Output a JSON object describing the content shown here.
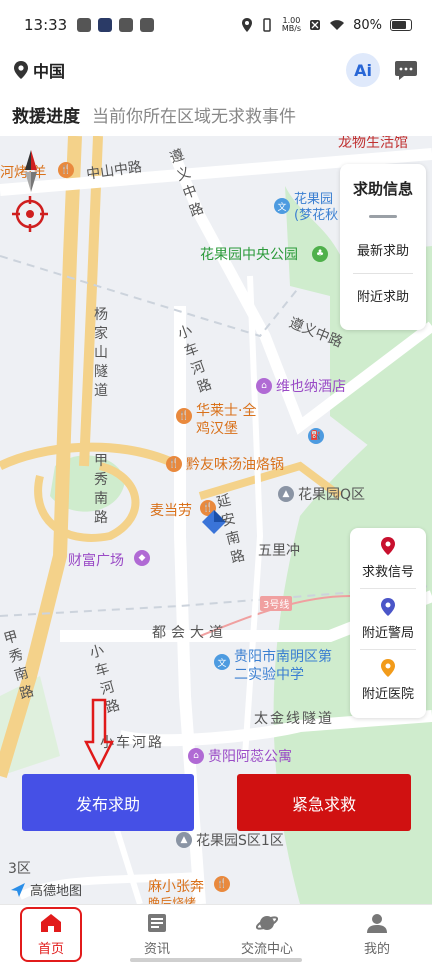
{
  "status": {
    "time": "13:33",
    "speed_value": "1.00",
    "speed_unit": "MB/s",
    "battery": "80%"
  },
  "header": {
    "location": "中国",
    "ai_label": "Ai"
  },
  "rescue": {
    "label": "救援进度",
    "message": "当前你所在区域无求救事件"
  },
  "help_panel": {
    "title": "求助信息",
    "items": [
      "最新求助",
      "附近求助"
    ]
  },
  "signal_panel": {
    "items": [
      {
        "label": "求救信号",
        "color": "#c8102e"
      },
      {
        "label": "附近警局",
        "color": "#4b56c8"
      },
      {
        "label": "附近医院",
        "color": "#f29b1a"
      }
    ]
  },
  "map": {
    "labels": {
      "top_right": "龙物生活馆",
      "bbq": "河烤·羊",
      "zhongshan": "中山中路",
      "zunyi": "遵义中路",
      "huaguo_school": "花果园(梦花秋",
      "park": "花果园中央公园",
      "zunyi2": "遵义中路",
      "yangjia": "杨家山隧道",
      "xiaochehe": "小车河路",
      "weiyena": "维也纳酒店",
      "hualashi": "华莱士·全鸡汉堡",
      "qianyou": "黔友味汤油烙锅",
      "jiaxiu": "甲秀南路",
      "maidanglao": "麦当劳",
      "yanan": "延安南路",
      "qzone": "花果园Q区",
      "wulichong": "五里冲",
      "caifu": "财富广场",
      "line3": "3号线",
      "duhui": "都会大道",
      "nanming": "贵阳市南明区第二实验中学",
      "jiaxiu2": "甲秀南路",
      "xiaochehe2": "小车河路",
      "taijin": "太金线隧道",
      "xiaochehe3": "小车河路",
      "aruiz": "贵阳阿蕊公寓",
      "s1": "花果园S区1区",
      "s3": "3区",
      "mazhang": "麻小张奔",
      "wanting": "晚后烧烤",
      "amap": "高德地图"
    }
  },
  "buttons": {
    "publish": "发布求助",
    "sos": "紧急求救"
  },
  "nav": {
    "tabs": [
      "首页",
      "资讯",
      "交流中心",
      "我的"
    ]
  },
  "colors": {
    "accent_blue": "#4550e6",
    "sos_red": "#d01111",
    "nav_active": "#e21b1b"
  }
}
